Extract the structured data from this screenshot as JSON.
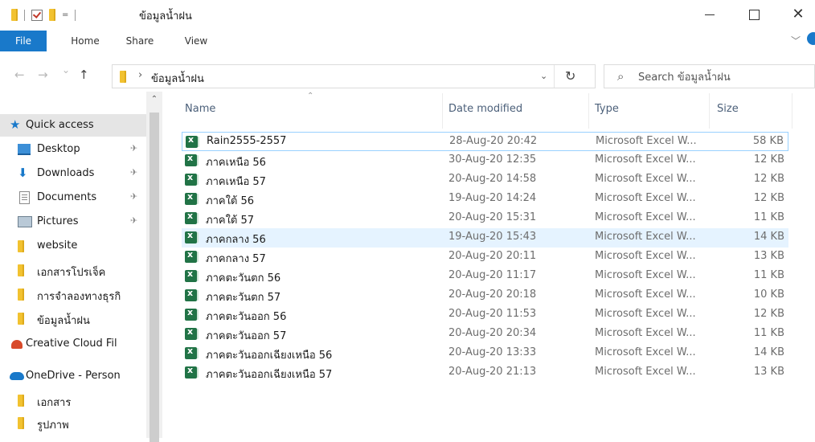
{
  "window": {
    "title": "ข้อมูลน้ำฝน",
    "qat_arrow": "=",
    "close_glyph": "✕"
  },
  "ribbon": {
    "tabs": [
      {
        "label": "File"
      },
      {
        "label": "Home"
      },
      {
        "label": "Share"
      },
      {
        "label": "View"
      }
    ],
    "collapse_glyph": "﹀"
  },
  "navigation": {
    "back_glyph": "←",
    "forward_glyph": "→",
    "recent_glyph": "⌄",
    "up_glyph": "↑",
    "breadcrumb_sep": "›",
    "address_path": "ข้อมูลน้ำฝน",
    "address_dropdown_glyph": "⌄",
    "refresh_glyph": "↻",
    "search_glyph": "⌕",
    "search_placeholder": "Search ข้อมูลน้ำฝน"
  },
  "nav_pane": {
    "scroll_up_glyph": "⌃",
    "pin_glyph": "✈",
    "quick_access_glyph": "★",
    "downloads_glyph": "⬇",
    "items": [
      {
        "label": "Quick access"
      },
      {
        "label": "Desktop"
      },
      {
        "label": "Downloads"
      },
      {
        "label": "Documents"
      },
      {
        "label": "Pictures"
      },
      {
        "label": "website"
      },
      {
        "label": "เอกสารโปรเจ็ค"
      },
      {
        "label": "การจำลองทางธุรกิ"
      },
      {
        "label": "ข้อมูลน้ำฝน"
      },
      {
        "label": "Creative Cloud Fil"
      },
      {
        "label": "OneDrive - Person"
      },
      {
        "label": "เอกสาร"
      },
      {
        "label": "รูปภาพ"
      }
    ]
  },
  "file_list": {
    "sort_glyph": "⌃",
    "columns": {
      "name": "Name",
      "date": "Date modified",
      "type": "Type",
      "size": "Size"
    },
    "rows": [
      {
        "name": "Rain2555-2557",
        "date": "28-Aug-20 20:42",
        "type": "Microsoft Excel W...",
        "size": "58 KB"
      },
      {
        "name": "ภาคเหนือ 56",
        "date": "30-Aug-20 12:35",
        "type": "Microsoft Excel W...",
        "size": "12 KB"
      },
      {
        "name": "ภาคเหนือ 57",
        "date": "20-Aug-20 14:58",
        "type": "Microsoft Excel W...",
        "size": "12 KB"
      },
      {
        "name": "ภาคใต้ 56",
        "date": "19-Aug-20 14:24",
        "type": "Microsoft Excel W...",
        "size": "12 KB"
      },
      {
        "name": "ภาคใต้ 57",
        "date": "20-Aug-20 15:31",
        "type": "Microsoft Excel W...",
        "size": "11 KB"
      },
      {
        "name": "ภาคกลาง 56",
        "date": "19-Aug-20 15:43",
        "type": "Microsoft Excel W...",
        "size": "14 KB"
      },
      {
        "name": "ภาคกลาง 57",
        "date": "20-Aug-20 20:11",
        "type": "Microsoft Excel W...",
        "size": "13 KB"
      },
      {
        "name": "ภาคตะวันตก 56",
        "date": "20-Aug-20 11:17",
        "type": "Microsoft Excel W...",
        "size": "11 KB"
      },
      {
        "name": "ภาคตะวันตก 57",
        "date": "20-Aug-20 20:18",
        "type": "Microsoft Excel W...",
        "size": "10 KB"
      },
      {
        "name": "ภาคตะวันออก 56",
        "date": "20-Aug-20 11:53",
        "type": "Microsoft Excel W...",
        "size": "12 KB"
      },
      {
        "name": "ภาคตะวันออก 57",
        "date": "20-Aug-20 20:34",
        "type": "Microsoft Excel W...",
        "size": "11 KB"
      },
      {
        "name": "ภาคตะวันออกเฉียงเหนือ 56",
        "date": "20-Aug-20 13:33",
        "type": "Microsoft Excel W...",
        "size": "14 KB"
      },
      {
        "name": "ภาคตะวันออกเฉียงเหนือ 57",
        "date": "20-Aug-20 21:13",
        "type": "Microsoft Excel W...",
        "size": "13 KB"
      }
    ]
  },
  "colors": {
    "accent": "#1979ca",
    "folder": "#f2c230",
    "excel": "#217346",
    "selected_row": "#e5f3ff",
    "focus_border": "#99d1ff"
  }
}
